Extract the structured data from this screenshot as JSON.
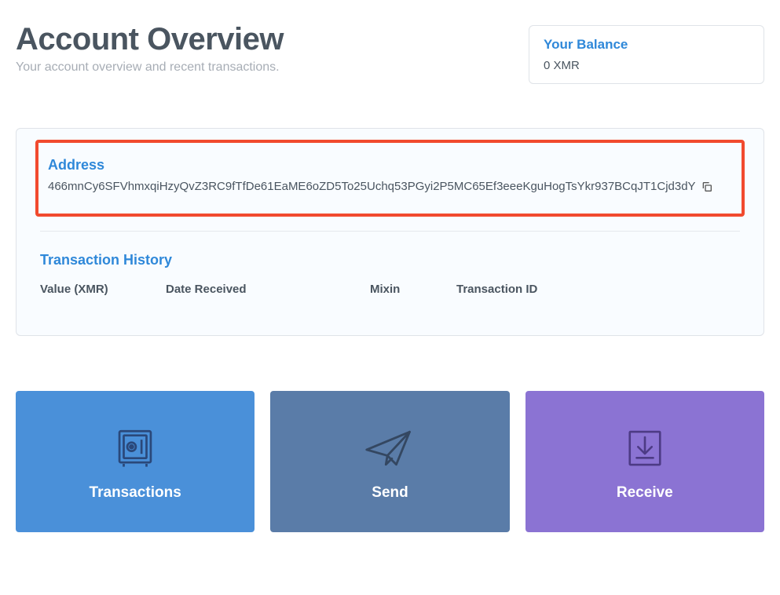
{
  "header": {
    "title": "Account Overview",
    "subtitle": "Your account overview and recent transactions."
  },
  "balance": {
    "label": "Your Balance",
    "value": "0 XMR"
  },
  "address": {
    "label": "Address",
    "value": "466mnCy6SFVhmxqiHzyQvZ3RC9fTfDe61EaME6oZD5To25Uchq53PGyi2P5MC65Ef3eeeKguHogTsYkr937BCqJT1Cjd3dY"
  },
  "transactions": {
    "label": "Transaction History",
    "columns": {
      "value": "Value (XMR)",
      "date": "Date Received",
      "mixin": "Mixin",
      "txid": "Transaction ID"
    }
  },
  "tiles": {
    "transactions": "Transactions",
    "send": "Send",
    "receive": "Receive"
  }
}
